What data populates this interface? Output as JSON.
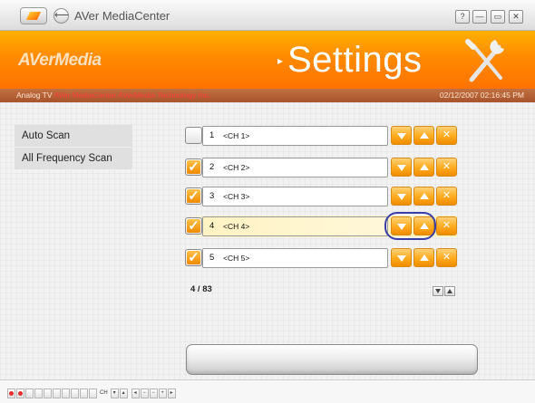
{
  "window": {
    "title": "AVer MediaCenter",
    "controls": [
      "?",
      "—",
      "▭",
      "✕"
    ]
  },
  "header": {
    "logo": "AVerMedia",
    "heading": "Settings",
    "icon": "tools-icon"
  },
  "status": {
    "mode": "Analog TV",
    "product": "AVer MediaCenter AVerMedia Technology Inc.",
    "datetime": "02/12/2007 02:16:45 PM"
  },
  "menu": {
    "items": [
      {
        "label": "Auto Scan"
      },
      {
        "label": "All Frequency Scan"
      }
    ]
  },
  "channels": [
    {
      "num": "1",
      "name": "<CH 1>",
      "checked": false
    },
    {
      "num": "2",
      "name": "<CH 2>",
      "checked": true
    },
    {
      "num": "3",
      "name": "<CH 3>",
      "checked": true
    },
    {
      "num": "4",
      "name": "<CH 4>",
      "checked": true,
      "selected": true
    },
    {
      "num": "5",
      "name": "<CH 5>",
      "checked": true
    }
  ],
  "row_buttons": [
    "move-down-icon",
    "move-up-icon",
    "delete-icon"
  ],
  "pagination": {
    "count": "4 / 83"
  },
  "bottom_bar": {
    "channel_label": "CH"
  },
  "colors": {
    "accent": "#ff8a00",
    "highlight": "#fff3c3",
    "focus_ring": "#3a3fa8"
  }
}
